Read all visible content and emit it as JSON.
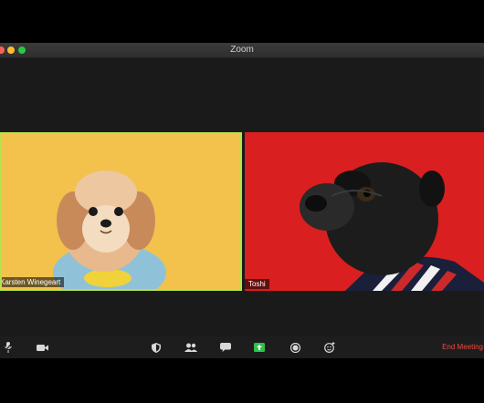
{
  "window": {
    "title": "Zoom"
  },
  "participants": [
    {
      "name": "Karsten Winegeart",
      "active_speaker": true
    },
    {
      "name": "Toshi",
      "active_speaker": false
    }
  ],
  "toolbar": {
    "end_label": "End Meeting",
    "icons": [
      "mute-icon",
      "video-icon",
      "security-icon",
      "participants-icon",
      "chat-icon",
      "share-screen-icon",
      "record-icon",
      "reactions-icon"
    ]
  },
  "colors": {
    "active_border": "#b6e34a",
    "share_green": "#2ec24a",
    "end_red": "#f04a3e",
    "left_background": "#f2c24c",
    "right_background": "#d91f1f"
  }
}
